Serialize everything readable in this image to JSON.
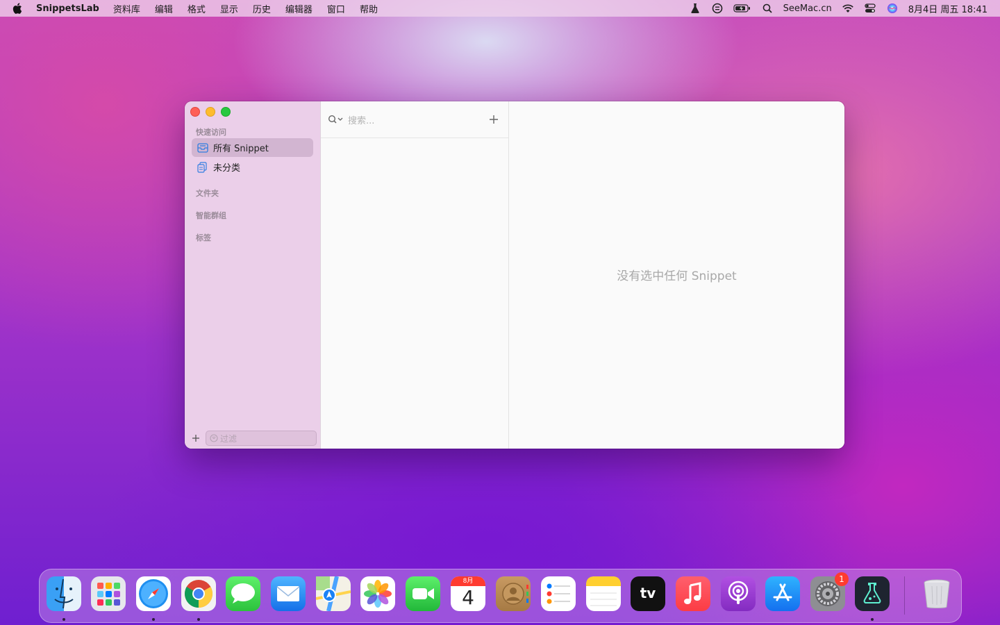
{
  "menubar": {
    "app_name": "SnippetsLab",
    "menus": [
      "资料库",
      "编辑",
      "格式",
      "显示",
      "历史",
      "编辑器",
      "窗口",
      "帮助"
    ],
    "site": "SeeMac.cn",
    "datetime": "8月4日 周五  18:41",
    "status_icons": [
      "lab-flask-icon",
      "snippets-status-icon",
      "battery-icon",
      "search-icon",
      "wifi-icon",
      "control-center-icon",
      "siri-icon"
    ]
  },
  "sidebar": {
    "sections": {
      "quick_access": "快速访问",
      "folders": "文件夹",
      "smart_groups": "智能群组",
      "tags": "标签"
    },
    "items": [
      {
        "label": "所有 Snippet",
        "icon": "tray-icon",
        "selected": true
      },
      {
        "label": "未分类",
        "icon": "documents-icon",
        "selected": false
      }
    ],
    "filter_placeholder": "过滤"
  },
  "list": {
    "search_placeholder": "搜索..."
  },
  "detail": {
    "empty_message": "没有选中任何 Snippet"
  },
  "dock": {
    "apps": [
      {
        "name": "finder-icon",
        "running": true
      },
      {
        "name": "launchpad-icon",
        "running": false
      },
      {
        "name": "safari-icon",
        "running": true
      },
      {
        "name": "chrome-icon",
        "running": true
      },
      {
        "name": "messages-icon",
        "running": false
      },
      {
        "name": "mail-icon",
        "running": false
      },
      {
        "name": "maps-icon",
        "running": false
      },
      {
        "name": "photos-icon",
        "running": false
      },
      {
        "name": "facetime-icon",
        "running": false
      },
      {
        "name": "calendar-icon",
        "running": false
      },
      {
        "name": "contacts-icon",
        "running": false
      },
      {
        "name": "reminders-icon",
        "running": false
      },
      {
        "name": "notes-icon",
        "running": false
      },
      {
        "name": "apple-tv-icon",
        "running": false
      },
      {
        "name": "music-icon",
        "running": false
      },
      {
        "name": "podcasts-icon",
        "running": false
      },
      {
        "name": "app-store-icon",
        "running": false
      },
      {
        "name": "system-preferences-icon",
        "running": false
      },
      {
        "name": "snippetslab-icon",
        "running": true
      },
      {
        "name": "trash-icon",
        "running": false
      }
    ],
    "calendar_month": "8月",
    "calendar_day": "4",
    "tv_label": "tv",
    "settings_badge": "1"
  }
}
